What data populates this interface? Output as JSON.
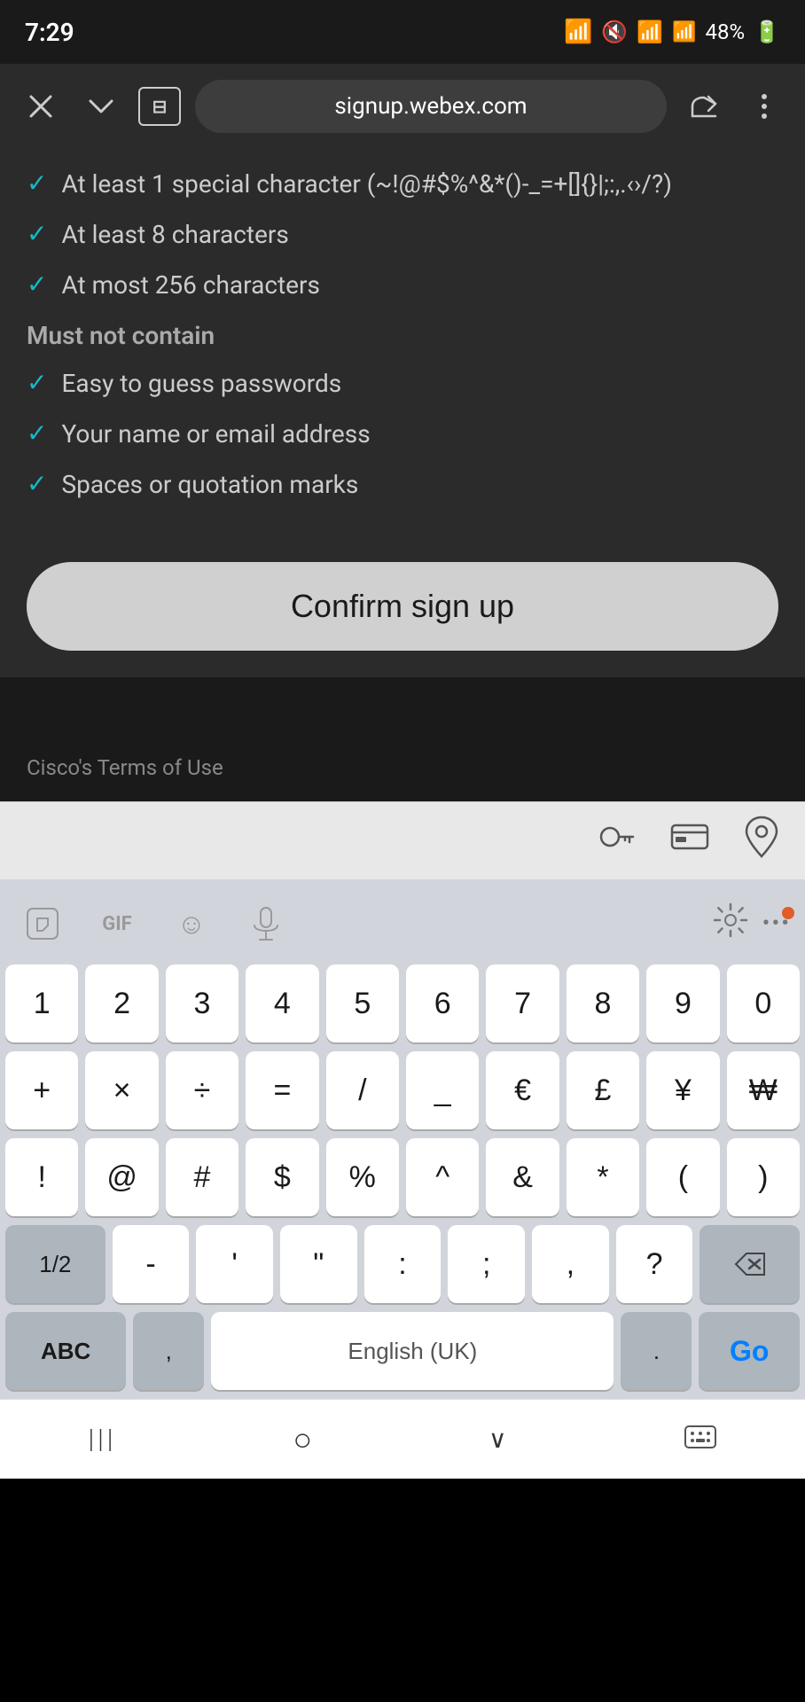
{
  "statusBar": {
    "time": "7:29",
    "batteryPercent": "48%"
  },
  "browserChrome": {
    "url": "signup.webex.com",
    "closeLabel": "✕",
    "dropdownLabel": "⌄",
    "tabsLabel": "⊟",
    "shareLabel": "share",
    "menuLabel": "⋮"
  },
  "passwordRules": {
    "specialCharNote": "At least 1 special character (~!@#$%^&*()-_=+[]{}|;:,.‹›/?)",
    "rule1": "At least 8 characters",
    "rule2": "At most 256 characters",
    "mustNotContainHeading": "Must not contain",
    "rule3": "Easy to guess passwords",
    "rule4": "Your name or email address",
    "rule5": "Spaces or quotation marks"
  },
  "confirmButton": {
    "label": "Confirm sign up"
  },
  "termsText": "Cisco's Terms of Use",
  "keyboard": {
    "row1": [
      "1",
      "2",
      "3",
      "4",
      "5",
      "6",
      "7",
      "8",
      "9",
      "0"
    ],
    "row2": [
      "+",
      "×",
      "÷",
      "=",
      "/",
      "_",
      "€",
      "£",
      "¥",
      "₩"
    ],
    "row3": [
      "!",
      "@",
      "#",
      "$",
      "%",
      "^",
      "&",
      "*",
      "(",
      ")"
    ],
    "halfLabel": "1/2",
    "row4": [
      "-",
      "'",
      "\"",
      ":",
      ";",
      " , ",
      "?"
    ],
    "abcLabel": "ABC",
    "commaLabel": ",",
    "spaceLabel": "English (UK)",
    "dotLabel": ".",
    "goLabel": "Go"
  },
  "navBar": {
    "backIcon": "|||",
    "homeIcon": "○",
    "recentIcon": "∨",
    "keyboardIcon": "⌨"
  }
}
